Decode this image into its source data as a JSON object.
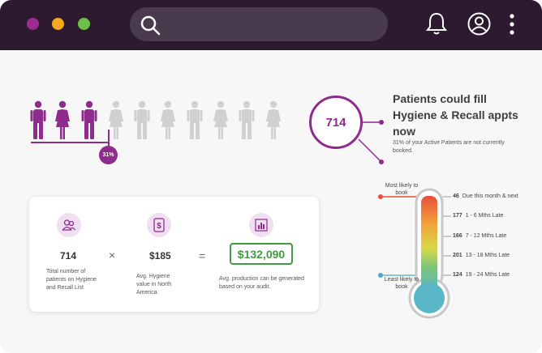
{
  "window": {
    "dots": [
      "#9b2b8f",
      "#f5a623",
      "#6cc04a"
    ]
  },
  "search": {
    "placeholder": ""
  },
  "people": {
    "highlighted_count": 3,
    "total_count": 10,
    "highlight_color": "#8e2b8c",
    "muted_color": "#d0d0d0",
    "percent_label": "31%"
  },
  "headline": {
    "value": "714",
    "title": "Patients could fill Hygiene & Recall appts now",
    "subtitle": "31% of your Active Patients are not currently booked."
  },
  "calc": {
    "patients_value": "714",
    "patients_label": "Total number of patients on Hygiene and Recall List",
    "times": "×",
    "avg_value": "$185",
    "avg_label": "Avg. Hygiene value in North America",
    "equals": "=",
    "result_value": "$132,090",
    "result_label": "Avg. production can be generated based on your audit."
  },
  "thermometer": {
    "most_likely": "Most likely to book",
    "least_likely": "Least likely to book",
    "rows": [
      {
        "count": "46",
        "label": "Due this month & next"
      },
      {
        "count": "177",
        "label": "1 - 6 Mths Late"
      },
      {
        "count": "166",
        "label": "7 - 12 Mths Late"
      },
      {
        "count": "201",
        "label": "13 - 18 Mths Late"
      },
      {
        "count": "124",
        "label": "19 - 24 Mths Late"
      }
    ]
  }
}
